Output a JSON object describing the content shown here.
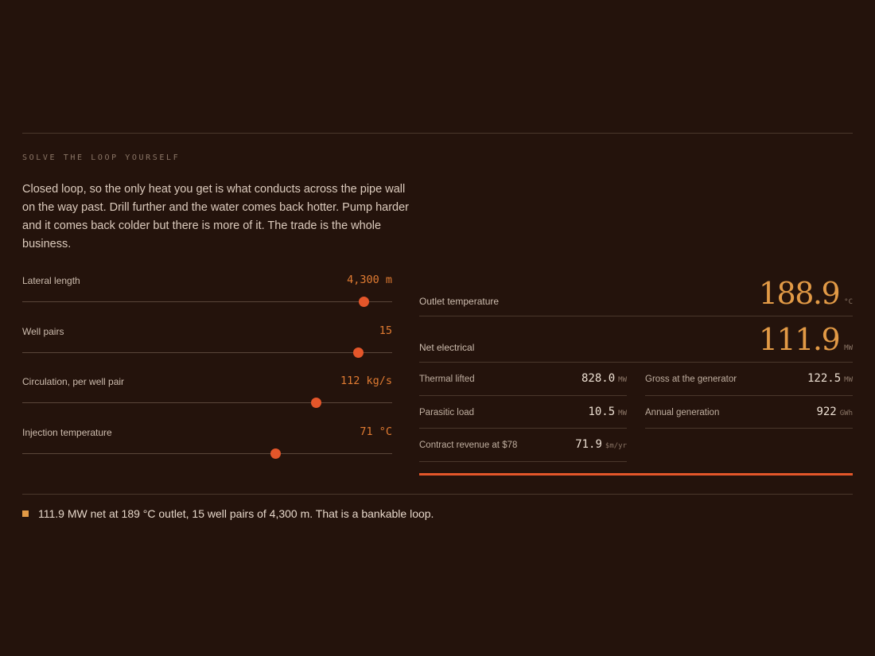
{
  "section": {
    "eyebrow": "SOLVE THE LOOP YOURSELF",
    "intro": "Closed loop, so the only heat you get is what conducts across the pipe wall on the way past. Drill further and the water comes back hotter. Pump harder and it comes back colder but there is more of it. The trade is the whole business."
  },
  "controls": [
    {
      "label": "Lateral length",
      "value": "4,300 m",
      "position": 0.924
    },
    {
      "label": "Well pairs",
      "value": "15",
      "position": 0.908
    },
    {
      "label": "Circulation, per well pair",
      "value": "112 kg/s",
      "position": 0.794
    },
    {
      "label": "Injection temperature",
      "value": "71 °C",
      "position": 0.684
    }
  ],
  "readouts": {
    "outlet": {
      "label": "Outlet temperature",
      "value": "188.9",
      "unit": "°C"
    },
    "net": {
      "label": "Net electrical",
      "value": "111.9",
      "unit": "MW"
    },
    "thermal": {
      "label": "Thermal lifted",
      "value": "828.0",
      "unit": "MW"
    },
    "gross": {
      "label": "Gross at the generator",
      "value": "122.5",
      "unit": "MW"
    },
    "parasitic": {
      "label": "Parasitic load",
      "value": "10.5",
      "unit": "MW"
    },
    "annual": {
      "label": "Annual generation",
      "value": "922",
      "unit": "GWh"
    },
    "revenue": {
      "label": "Contract revenue at $78",
      "value": "71.9",
      "unit": "$m/yr"
    }
  },
  "verdict": "111.9 MW net at 189 °C outlet, 15 well pairs of 4,300 m. That is a bankable loop.",
  "colors": {
    "accent": "#e4562a",
    "highlight": "#e29a46",
    "background": "#24130c"
  }
}
